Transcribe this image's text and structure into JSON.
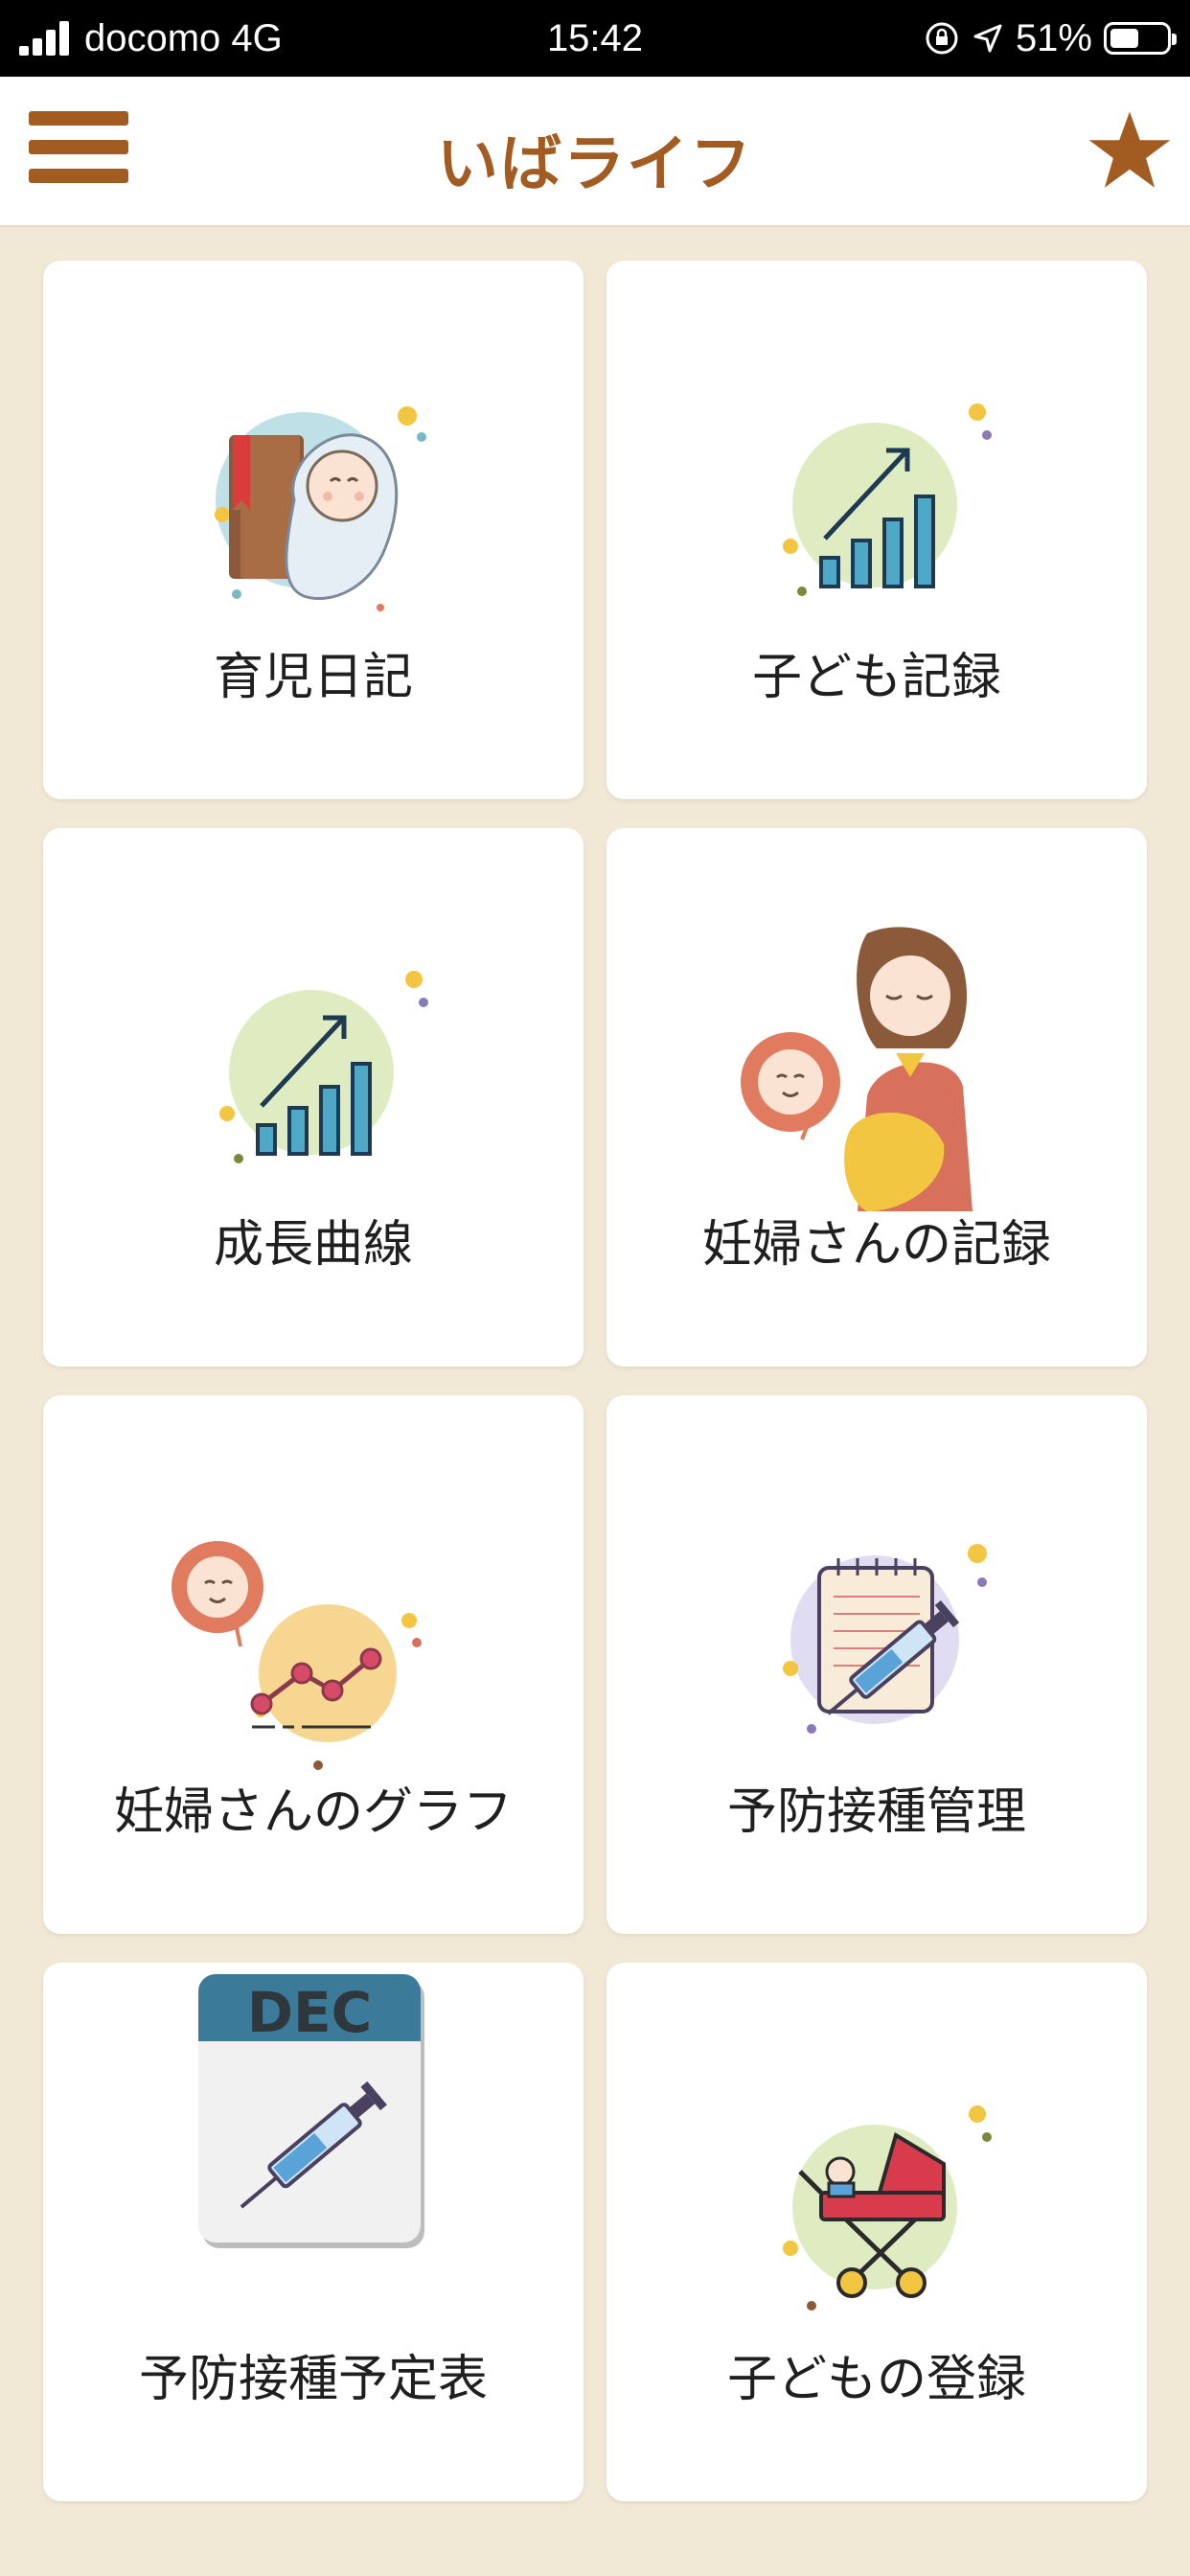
{
  "status_bar": {
    "carrier": "docomo 4G",
    "time": "15:42",
    "battery": "51%",
    "battery_level": 0.51
  },
  "header": {
    "title": "いばライフ",
    "menu_icon": "hamburger-menu-icon",
    "favorite_icon": "star-icon"
  },
  "colors": {
    "brand": "#a25c22",
    "background": "#f1e9d6"
  },
  "menu_items": [
    {
      "label": "育児日記",
      "icon": "baby-diary-icon"
    },
    {
      "label": "子ども記録",
      "icon": "growth-chart-icon"
    },
    {
      "label": "成長曲線",
      "icon": "growth-curve-icon"
    },
    {
      "label": "妊婦さんの記録",
      "icon": "pregnant-woman-icon"
    },
    {
      "label": "妊婦さんのグラフ",
      "icon": "pregnancy-graph-icon"
    },
    {
      "label": "予防接種管理",
      "icon": "vaccination-notebook-icon"
    },
    {
      "label": "予防接種予定表",
      "icon": "vaccination-calendar-icon",
      "calendar_text": "DEC"
    },
    {
      "label": "子どもの登録",
      "icon": "stroller-icon"
    }
  ]
}
